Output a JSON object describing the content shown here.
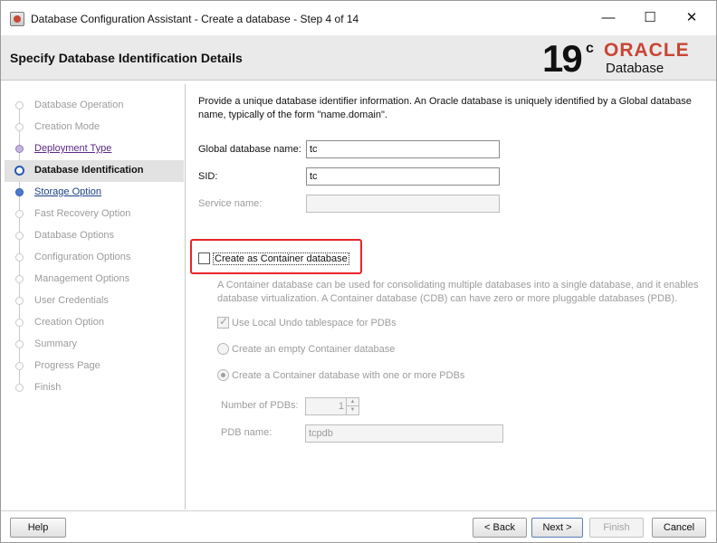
{
  "window": {
    "title": "Database Configuration Assistant - Create a database - Step 4 of 14",
    "minimize": "—",
    "maximize": "☐",
    "close": "✕"
  },
  "header": {
    "title": "Specify Database Identification Details",
    "logo_version": "19",
    "logo_sup": "c",
    "logo_brand": "ORACLE",
    "logo_product": "Database"
  },
  "steps": [
    {
      "label": "Database Operation",
      "state": "disabled"
    },
    {
      "label": "Creation Mode",
      "state": "disabled"
    },
    {
      "label": "Deployment Type",
      "state": "link"
    },
    {
      "label": "Database Identification",
      "state": "current"
    },
    {
      "label": "Storage Option",
      "state": "next"
    },
    {
      "label": "Fast Recovery Option",
      "state": "disabled"
    },
    {
      "label": "Database Options",
      "state": "disabled"
    },
    {
      "label": "Configuration Options",
      "state": "disabled"
    },
    {
      "label": "Management Options",
      "state": "disabled"
    },
    {
      "label": "User Credentials",
      "state": "disabled"
    },
    {
      "label": "Creation Option",
      "state": "disabled"
    },
    {
      "label": "Summary",
      "state": "disabled"
    },
    {
      "label": "Progress Page",
      "state": "disabled"
    },
    {
      "label": "Finish",
      "state": "disabled"
    }
  ],
  "main": {
    "intro": "Provide a unique database identifier information. An Oracle database is uniquely identified by a Global database name, typically of the form \"name.domain\".",
    "global_db_label": "Global database name:",
    "global_db_value": "tc",
    "sid_label": "SID:",
    "sid_value": "tc",
    "service_label": "Service name:",
    "service_value": "",
    "cdb_label": "Create as Container database",
    "cdb_checked": false,
    "cdb_description": "A Container database can be used for consolidating multiple databases into a single database, and it enables database virtualization. A Container database (CDB) can have zero or more pluggable databases (PDB).",
    "local_undo_label": "Use Local Undo tablespace for PDBs",
    "local_undo_checked": true,
    "empty_cdb_label": "Create an empty Container database",
    "with_pdbs_label": "Create a Container database with one or more PDBs",
    "num_pdbs_label": "Number of PDBs:",
    "num_pdbs_value": "1",
    "pdb_name_label": "PDB name:",
    "pdb_name_value": "tcpdb"
  },
  "footer": {
    "help": "Help",
    "back": "< Back",
    "next": "Next >",
    "finish": "Finish",
    "cancel": "Cancel"
  },
  "colors": {
    "oracle_red": "#c74634",
    "highlight_box": "#e8242a",
    "current_step_bg": "#e2e2e2",
    "link_purple": "#5a2a82",
    "next_blue": "#1d3f8a"
  }
}
